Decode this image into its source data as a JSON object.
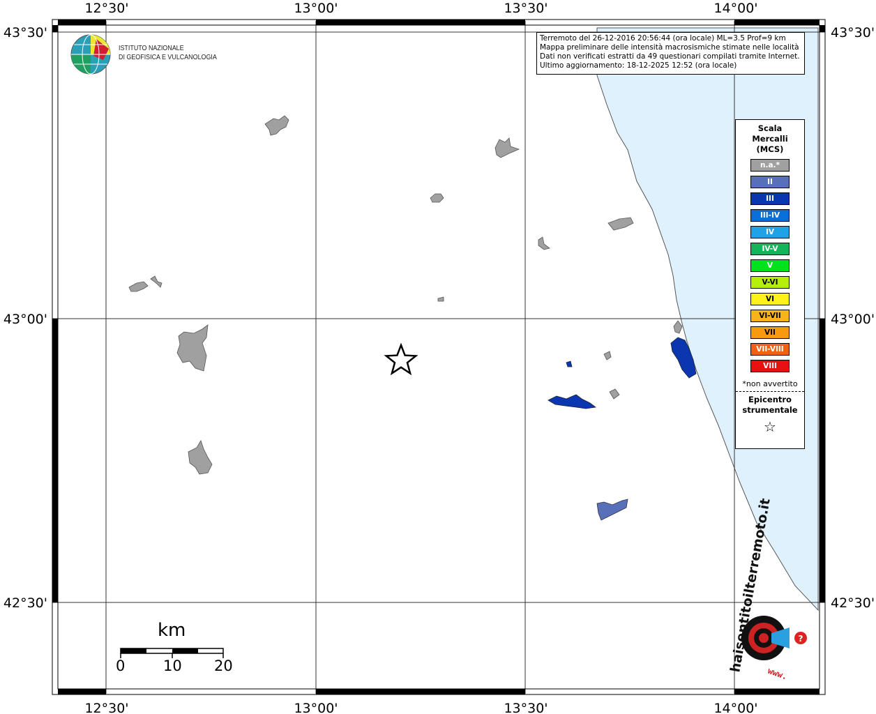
{
  "axes": {
    "top_labels": [
      "12°30'",
      "13°00'",
      "13°30'",
      "14°00'"
    ],
    "bottom_labels": [
      "12°30'",
      "13°00'",
      "13°30'",
      "14°00'"
    ],
    "left_labels": [
      "43°30'",
      "43°00'",
      "42°30'"
    ],
    "right_labels": [
      "43°30'",
      "43°00'",
      "42°30'"
    ]
  },
  "institute": {
    "line1": "ISTITUTO NAZIONALE",
    "line2": "DI GEOFISICA E VULCANOLOGIA"
  },
  "info": {
    "line1": "Terremoto del 26-12-2016 20:56:44 (ora locale) ML=3.5 Prof=9 km",
    "line2": "Mappa preliminare delle intensità macrosismiche stimate nelle località",
    "line3": "Dati non verificati estratti da 49 questionari compilati tramite Internet.",
    "line4": "Ultimo aggiornamento: 18-12-2025 12:52 (ora locale)"
  },
  "legend": {
    "title1": "Scala",
    "title2": "Mercalli",
    "title3": "(MCS)",
    "items": [
      {
        "label": "n.a.*",
        "color": "#a0a0a0"
      },
      {
        "label": "II",
        "color": "#5870b8"
      },
      {
        "label": "III",
        "color": "#0a36b0"
      },
      {
        "label": "III-IV",
        "color": "#0a6fd8"
      },
      {
        "label": "IV",
        "color": "#1fa2e6"
      },
      {
        "label": "IV-V",
        "color": "#14b45a"
      },
      {
        "label": "V",
        "color": "#00e21c"
      },
      {
        "label": "V-VI",
        "color": "#b6f00a"
      },
      {
        "label": "VI",
        "color": "#fff21a"
      },
      {
        "label": "VI-VII",
        "color": "#f5b418"
      },
      {
        "label": "VII",
        "color": "#f79a10"
      },
      {
        "label": "VII-VIII",
        "color": "#ee6212"
      },
      {
        "label": "VIII",
        "color": "#e81010"
      }
    ],
    "note": "*non avvertito",
    "epi1": "Epicentro",
    "epi2": "strumentale",
    "star": "☆"
  },
  "scale": {
    "title": "km",
    "labels": [
      "0",
      "10",
      "20"
    ]
  },
  "haisentito": {
    "text": "haisentitoilterremoto.it",
    "url": "www."
  },
  "colors": {
    "sea": "#dff1fd",
    "na_locality": "#a0a0a0",
    "intensity_III": "#0a36b0",
    "intensity_II": "#5870b8"
  }
}
